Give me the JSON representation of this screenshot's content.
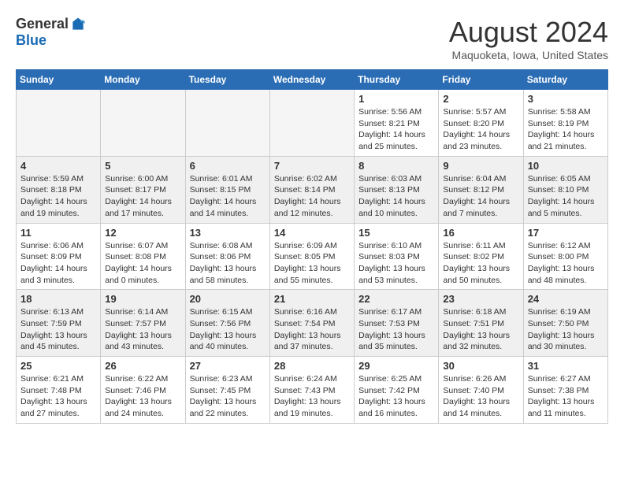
{
  "logo": {
    "general": "General",
    "blue": "Blue"
  },
  "title": "August 2024",
  "location": "Maquoketa, Iowa, United States",
  "weekdays": [
    "Sunday",
    "Monday",
    "Tuesday",
    "Wednesday",
    "Thursday",
    "Friday",
    "Saturday"
  ],
  "weeks": [
    [
      {
        "day": "",
        "info": ""
      },
      {
        "day": "",
        "info": ""
      },
      {
        "day": "",
        "info": ""
      },
      {
        "day": "",
        "info": ""
      },
      {
        "day": "1",
        "info": "Sunrise: 5:56 AM\nSunset: 8:21 PM\nDaylight: 14 hours\nand 25 minutes."
      },
      {
        "day": "2",
        "info": "Sunrise: 5:57 AM\nSunset: 8:20 PM\nDaylight: 14 hours\nand 23 minutes."
      },
      {
        "day": "3",
        "info": "Sunrise: 5:58 AM\nSunset: 8:19 PM\nDaylight: 14 hours\nand 21 minutes."
      }
    ],
    [
      {
        "day": "4",
        "info": "Sunrise: 5:59 AM\nSunset: 8:18 PM\nDaylight: 14 hours\nand 19 minutes."
      },
      {
        "day": "5",
        "info": "Sunrise: 6:00 AM\nSunset: 8:17 PM\nDaylight: 14 hours\nand 17 minutes."
      },
      {
        "day": "6",
        "info": "Sunrise: 6:01 AM\nSunset: 8:15 PM\nDaylight: 14 hours\nand 14 minutes."
      },
      {
        "day": "7",
        "info": "Sunrise: 6:02 AM\nSunset: 8:14 PM\nDaylight: 14 hours\nand 12 minutes."
      },
      {
        "day": "8",
        "info": "Sunrise: 6:03 AM\nSunset: 8:13 PM\nDaylight: 14 hours\nand 10 minutes."
      },
      {
        "day": "9",
        "info": "Sunrise: 6:04 AM\nSunset: 8:12 PM\nDaylight: 14 hours\nand 7 minutes."
      },
      {
        "day": "10",
        "info": "Sunrise: 6:05 AM\nSunset: 8:10 PM\nDaylight: 14 hours\nand 5 minutes."
      }
    ],
    [
      {
        "day": "11",
        "info": "Sunrise: 6:06 AM\nSunset: 8:09 PM\nDaylight: 14 hours\nand 3 minutes."
      },
      {
        "day": "12",
        "info": "Sunrise: 6:07 AM\nSunset: 8:08 PM\nDaylight: 14 hours\nand 0 minutes."
      },
      {
        "day": "13",
        "info": "Sunrise: 6:08 AM\nSunset: 8:06 PM\nDaylight: 13 hours\nand 58 minutes."
      },
      {
        "day": "14",
        "info": "Sunrise: 6:09 AM\nSunset: 8:05 PM\nDaylight: 13 hours\nand 55 minutes."
      },
      {
        "day": "15",
        "info": "Sunrise: 6:10 AM\nSunset: 8:03 PM\nDaylight: 13 hours\nand 53 minutes."
      },
      {
        "day": "16",
        "info": "Sunrise: 6:11 AM\nSunset: 8:02 PM\nDaylight: 13 hours\nand 50 minutes."
      },
      {
        "day": "17",
        "info": "Sunrise: 6:12 AM\nSunset: 8:00 PM\nDaylight: 13 hours\nand 48 minutes."
      }
    ],
    [
      {
        "day": "18",
        "info": "Sunrise: 6:13 AM\nSunset: 7:59 PM\nDaylight: 13 hours\nand 45 minutes."
      },
      {
        "day": "19",
        "info": "Sunrise: 6:14 AM\nSunset: 7:57 PM\nDaylight: 13 hours\nand 43 minutes."
      },
      {
        "day": "20",
        "info": "Sunrise: 6:15 AM\nSunset: 7:56 PM\nDaylight: 13 hours\nand 40 minutes."
      },
      {
        "day": "21",
        "info": "Sunrise: 6:16 AM\nSunset: 7:54 PM\nDaylight: 13 hours\nand 37 minutes."
      },
      {
        "day": "22",
        "info": "Sunrise: 6:17 AM\nSunset: 7:53 PM\nDaylight: 13 hours\nand 35 minutes."
      },
      {
        "day": "23",
        "info": "Sunrise: 6:18 AM\nSunset: 7:51 PM\nDaylight: 13 hours\nand 32 minutes."
      },
      {
        "day": "24",
        "info": "Sunrise: 6:19 AM\nSunset: 7:50 PM\nDaylight: 13 hours\nand 30 minutes."
      }
    ],
    [
      {
        "day": "25",
        "info": "Sunrise: 6:21 AM\nSunset: 7:48 PM\nDaylight: 13 hours\nand 27 minutes."
      },
      {
        "day": "26",
        "info": "Sunrise: 6:22 AM\nSunset: 7:46 PM\nDaylight: 13 hours\nand 24 minutes."
      },
      {
        "day": "27",
        "info": "Sunrise: 6:23 AM\nSunset: 7:45 PM\nDaylight: 13 hours\nand 22 minutes."
      },
      {
        "day": "28",
        "info": "Sunrise: 6:24 AM\nSunset: 7:43 PM\nDaylight: 13 hours\nand 19 minutes."
      },
      {
        "day": "29",
        "info": "Sunrise: 6:25 AM\nSunset: 7:42 PM\nDaylight: 13 hours\nand 16 minutes."
      },
      {
        "day": "30",
        "info": "Sunrise: 6:26 AM\nSunset: 7:40 PM\nDaylight: 13 hours\nand 14 minutes."
      },
      {
        "day": "31",
        "info": "Sunrise: 6:27 AM\nSunset: 7:38 PM\nDaylight: 13 hours\nand 11 minutes."
      }
    ]
  ]
}
